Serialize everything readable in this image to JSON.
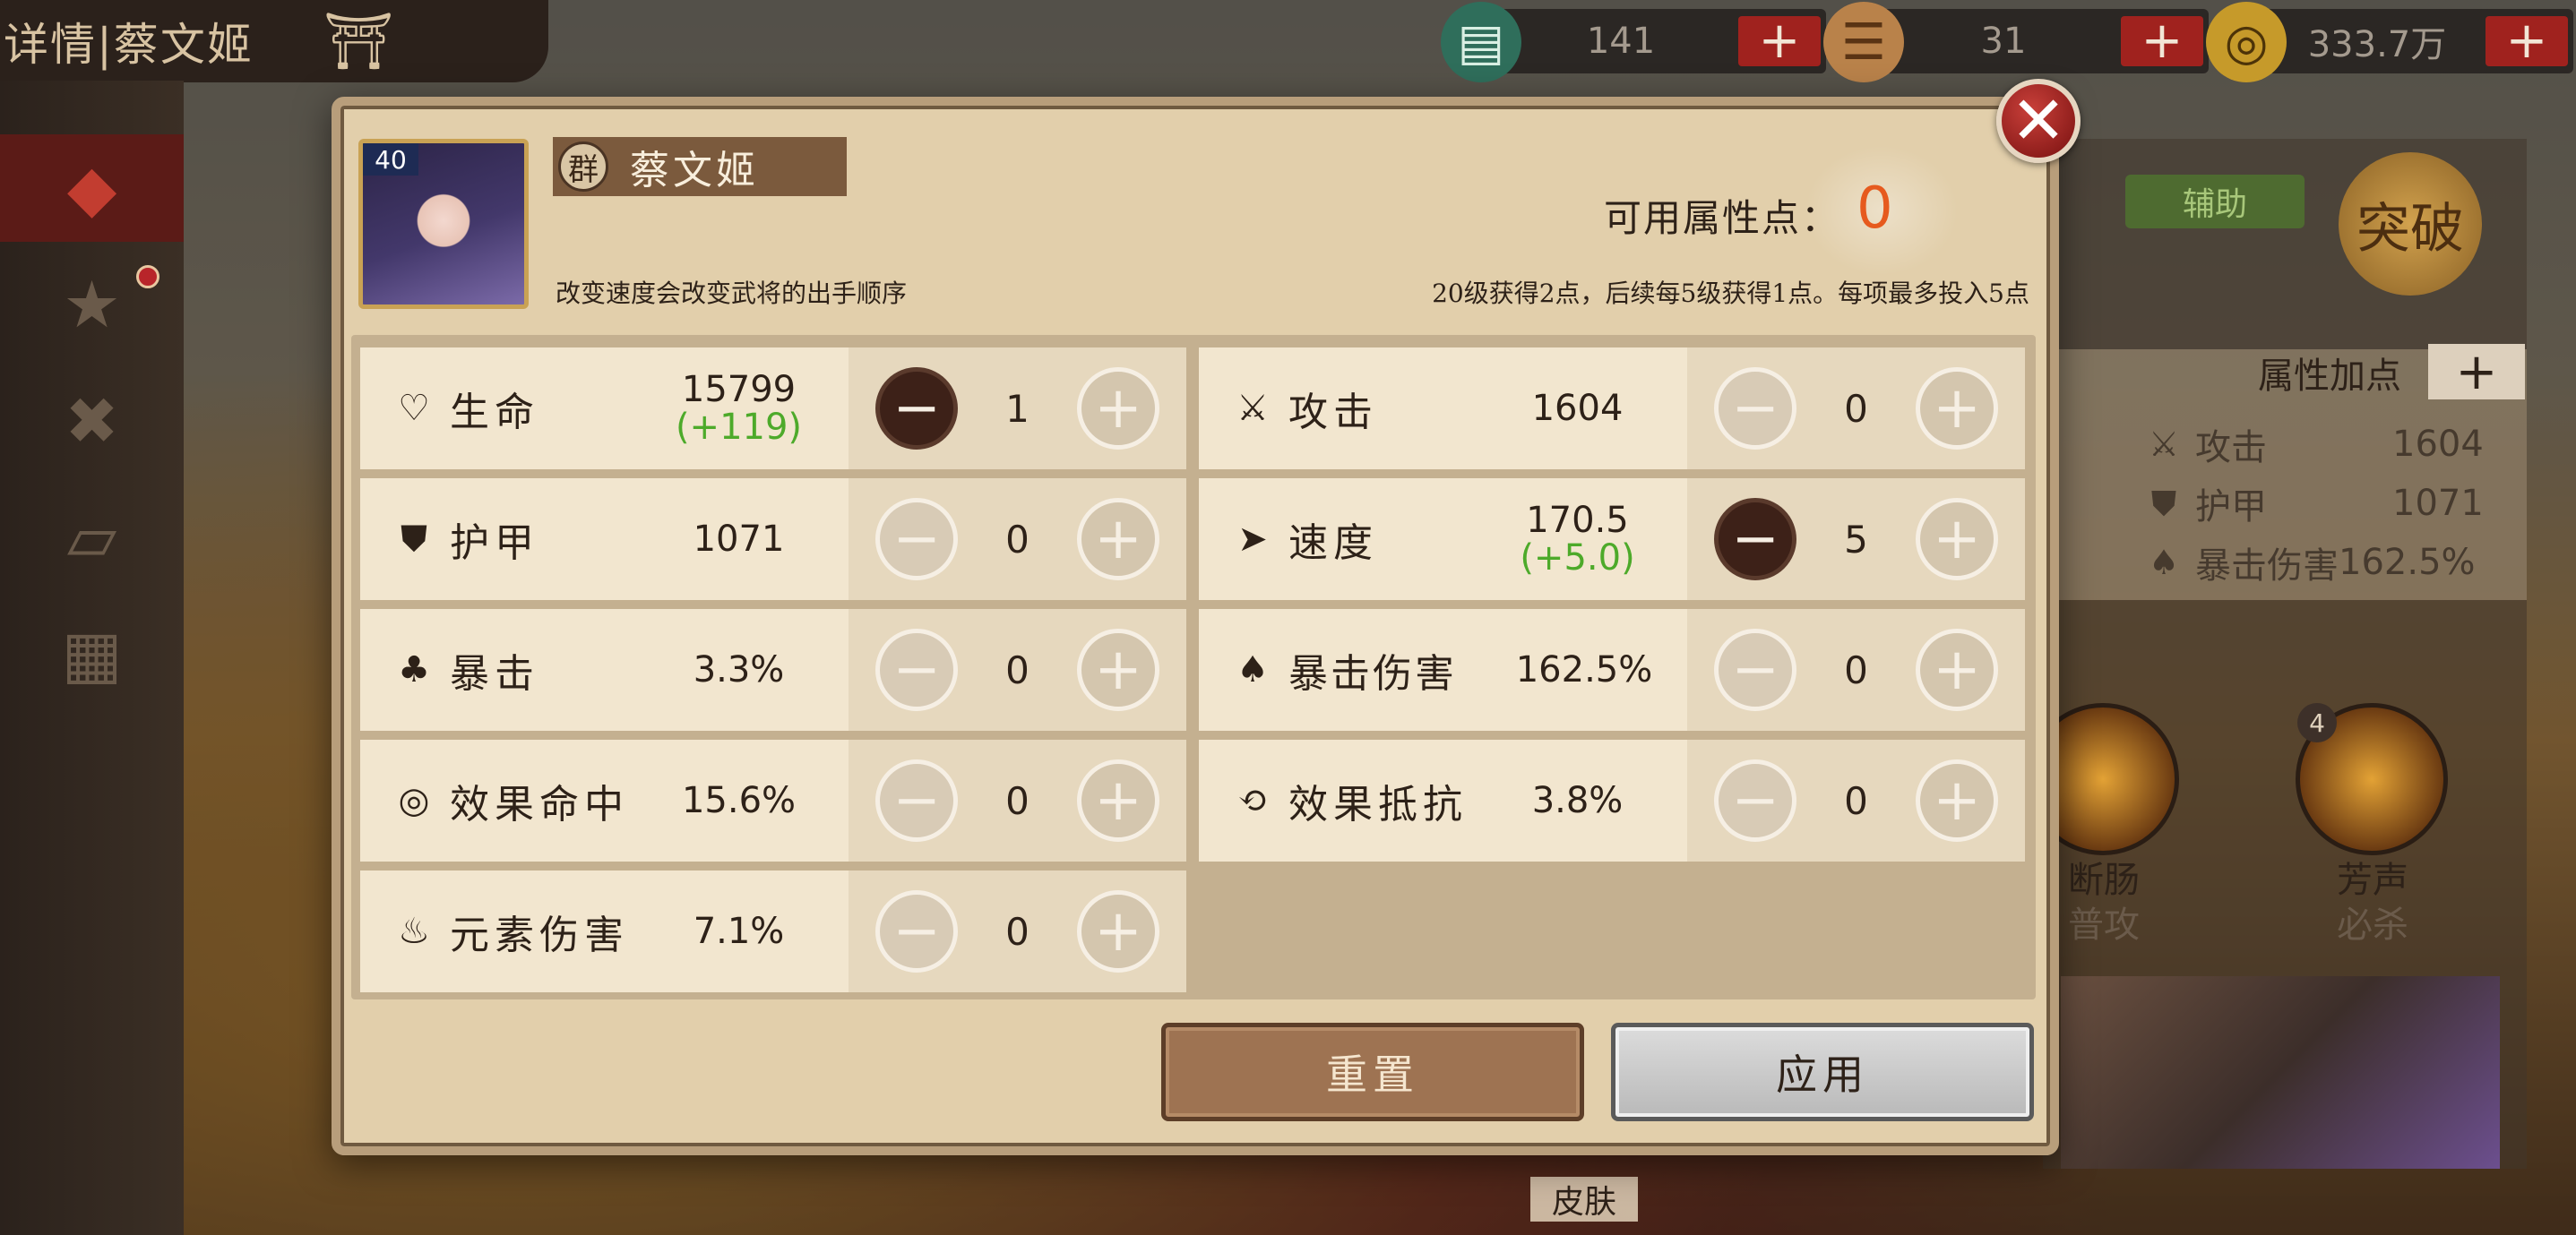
{
  "background": {
    "title": "详情|蔡文姬",
    "currencies": [
      {
        "icon": "book-icon",
        "value": "141",
        "plus": "+"
      },
      {
        "icon": "scroll-icon",
        "value": "31",
        "plus": "+"
      },
      {
        "icon": "coin-icon",
        "value": "333.7万",
        "plus": "+"
      }
    ],
    "side": {
      "role": "辅助",
      "breakthrough": "突破",
      "attr_header": "属性加点",
      "attr_plus": "+",
      "stats": [
        {
          "icon": "sword-icon",
          "name": "攻击",
          "value": "1604"
        },
        {
          "icon": "shield-icon",
          "name": "护甲",
          "value": "1071"
        },
        {
          "icon": "crit-damage-icon",
          "name": "暴击伤害",
          "value": "162.5%"
        }
      ],
      "skills": [
        {
          "badge": "",
          "name": "断肠",
          "type": "普攻"
        },
        {
          "badge": "4",
          "name": "芳声",
          "type": "必杀"
        }
      ],
      "skin": "皮肤"
    }
  },
  "modal": {
    "level": "40",
    "faction": "群",
    "hero_name": "蔡文姬",
    "hint_left": "改变速度会改变武将的出手顺序",
    "points_label": "可用属性点：",
    "points_value": "0",
    "hint_right": "20级获得2点，后续每5级获得1点。每项最多投入5点",
    "close": "✕",
    "stats_left": [
      {
        "icon": "heart-icon",
        "name": "生命",
        "value": "15799",
        "bonus": "(+119)",
        "count": "1",
        "minus_active": true
      },
      {
        "icon": "armor-icon",
        "name": "护甲",
        "value": "1071",
        "bonus": "",
        "count": "0",
        "minus_active": false
      },
      {
        "icon": "crit-icon",
        "name": "暴击",
        "value": "3.3%",
        "bonus": "",
        "count": "0",
        "minus_active": false
      },
      {
        "icon": "effect-hit-icon",
        "name": "效果命中",
        "value": "15.6%",
        "bonus": "",
        "count": "0",
        "minus_active": false
      },
      {
        "icon": "element-damage-icon",
        "name": "元素伤害",
        "value": "7.1%",
        "bonus": "",
        "count": "0",
        "minus_active": false
      }
    ],
    "stats_right": [
      {
        "icon": "attack-icon",
        "name": "攻击",
        "value": "1604",
        "bonus": "",
        "count": "0",
        "minus_active": false
      },
      {
        "icon": "speed-icon",
        "name": "速度",
        "value": "170.5",
        "bonus": "(+5.0)",
        "count": "5",
        "minus_active": true
      },
      {
        "icon": "crit-damage-icon",
        "name": "暴击伤害",
        "value": "162.5%",
        "bonus": "",
        "count": "0",
        "minus_active": false
      },
      {
        "icon": "effect-resist-icon",
        "name": "效果抵抗",
        "value": "3.8%",
        "bonus": "",
        "count": "0",
        "minus_active": false
      }
    ],
    "minus_symbol": "−",
    "plus_symbol": "+",
    "reset_label": "重置",
    "apply_label": "应用"
  },
  "colors": {
    "points_value": "#e65a1e",
    "bonus": "#4daa2a",
    "close_button": "#a8211f"
  }
}
